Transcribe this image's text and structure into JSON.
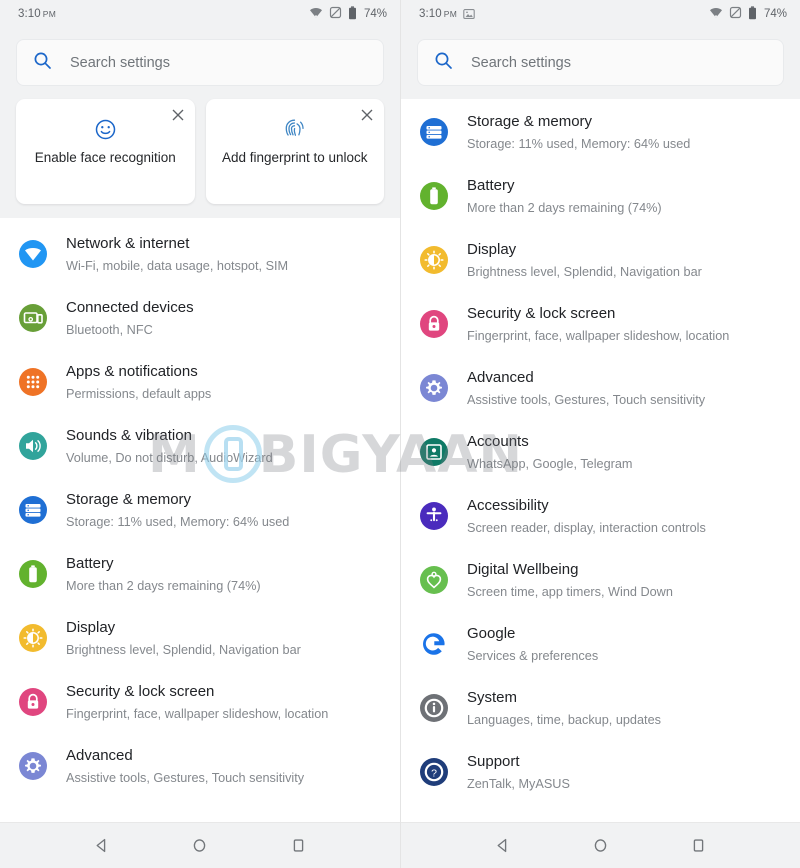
{
  "colors": {
    "page_bg": "#ffffff",
    "chrome_bg": "#f1f2f3",
    "title_text": "#212327",
    "sub_text": "#84888d",
    "search_icon": "#1b66c9",
    "watermark_gray": "#787c82",
    "watermark_blue": "#8ccdeb"
  },
  "left": {
    "status": {
      "time": "3:10",
      "ampm": "PM",
      "screenshot_icon": "image-icon",
      "wifi_icon": "wifi-icon",
      "mute_icon": "volume-off-icon",
      "battery_icon": "battery-icon",
      "battery_label": "74%",
      "has_screenshot_icon": false
    },
    "search": {
      "icon": "search-icon",
      "placeholder": "Search settings",
      "value": ""
    },
    "promo_cards": [
      {
        "icon": "face-smile-icon",
        "label": "Enable face recognition",
        "close_icon": "close-icon",
        "icon_color": "#1b66c9"
      },
      {
        "icon": "fingerprint-icon",
        "label": "Add fingerprint to unlock",
        "close_icon": "close-icon",
        "icon_color": "#4a8ec7"
      }
    ],
    "items": [
      {
        "title": "Network & internet",
        "subtitle": "Wi-Fi, mobile, data usage, hotspot, SIM",
        "icon": "wifi-circle-icon",
        "color": "#2196f3",
        "name": "network-internet"
      },
      {
        "title": "Connected devices",
        "subtitle": "Bluetooth, NFC",
        "icon": "devices-icon",
        "color": "#689f38",
        "name": "connected-devices"
      },
      {
        "title": "Apps & notifications",
        "subtitle": "Permissions, default apps",
        "icon": "apps-grid-icon",
        "color": "#ef7326",
        "name": "apps-notifications"
      },
      {
        "title": "Sounds & vibration",
        "subtitle": "Volume, Do not disturb, AudioWizard",
        "icon": "speaker-icon",
        "color": "#31a49b",
        "name": "sounds-vibration"
      },
      {
        "title": "Storage & memory",
        "subtitle": "Storage: 11% used, Memory: 64% used",
        "icon": "storage-icon",
        "color": "#1f6fd4",
        "name": "storage-memory"
      },
      {
        "title": "Battery",
        "subtitle": "More than 2 days remaining (74%)",
        "icon": "battery-circle-icon",
        "color": "#62b22e",
        "name": "battery"
      },
      {
        "title": "Display",
        "subtitle": "Brightness level, Splendid, Navigation bar",
        "icon": "brightness-icon",
        "color": "#f2bb2e",
        "name": "display"
      },
      {
        "title": "Security & lock screen",
        "subtitle": "Fingerprint, face, wallpaper slideshow, location",
        "icon": "lock-icon",
        "color": "#e0467f",
        "name": "security-lock-screen"
      },
      {
        "title": "Advanced",
        "subtitle": "Assistive tools, Gestures, Touch sensitivity",
        "icon": "gear-icon",
        "color": "#7b87d4",
        "name": "advanced"
      }
    ],
    "nav": {
      "back_icon": "back-triangle-icon",
      "home_icon": "home-circle-icon",
      "recents_icon": "recents-square-icon"
    }
  },
  "right": {
    "status": {
      "time": "3:10",
      "ampm": "PM",
      "screenshot_icon": "image-icon",
      "wifi_icon": "wifi-icon",
      "mute_icon": "volume-off-icon",
      "battery_icon": "battery-icon",
      "battery_label": "74%",
      "has_screenshot_icon": true
    },
    "search": {
      "icon": "search-icon",
      "placeholder": "Search settings",
      "value": ""
    },
    "items": [
      {
        "title": "Storage & memory",
        "subtitle": "Storage: 11% used, Memory: 64% used",
        "icon": "storage-icon",
        "color": "#1f6fd4",
        "name": "storage-memory"
      },
      {
        "title": "Battery",
        "subtitle": "More than 2 days remaining (74%)",
        "icon": "battery-circle-icon",
        "color": "#62b22e",
        "name": "battery"
      },
      {
        "title": "Display",
        "subtitle": "Brightness level, Splendid, Navigation bar",
        "icon": "brightness-icon",
        "color": "#f2bb2e",
        "name": "display"
      },
      {
        "title": "Security & lock screen",
        "subtitle": "Fingerprint, face, wallpaper slideshow, location",
        "icon": "lock-icon",
        "color": "#e0467f",
        "name": "security-lock-screen"
      },
      {
        "title": "Advanced",
        "subtitle": "Assistive tools, Gestures, Touch sensitivity",
        "icon": "gear-icon",
        "color": "#7b87d4",
        "name": "advanced"
      },
      {
        "title": "Accounts",
        "subtitle": "WhatsApp, Google, Telegram",
        "icon": "account-card-icon",
        "color": "#0f7a66",
        "name": "accounts"
      },
      {
        "title": "Accessibility",
        "subtitle": "Screen reader, display, interaction controls",
        "icon": "accessibility-icon",
        "color": "#4a2bbd",
        "name": "accessibility"
      },
      {
        "title": "Digital Wellbeing",
        "subtitle": "Screen time, app timers, Wind Down",
        "icon": "heart-icon",
        "color": "#67bf4f",
        "name": "digital-wellbeing"
      },
      {
        "title": "Google",
        "subtitle": "Services & preferences",
        "icon": "google-g-icon",
        "color": "#1a73e8",
        "name": "google"
      },
      {
        "title": "System",
        "subtitle": "Languages, time, backup, updates",
        "icon": "info-icon",
        "color": "#6e7176",
        "name": "system"
      },
      {
        "title": "Support",
        "subtitle": "ZenTalk, MyASUS",
        "icon": "help-icon",
        "color": "#1f3d7a",
        "name": "support"
      }
    ],
    "nav": {
      "back_icon": "back-triangle-icon",
      "home_icon": "home-circle-icon",
      "recents_icon": "recents-square-icon"
    }
  },
  "watermark": {
    "text_before": "M",
    "text_after": "BIGYAAN",
    "full_text": "MOBIGYAAN"
  }
}
